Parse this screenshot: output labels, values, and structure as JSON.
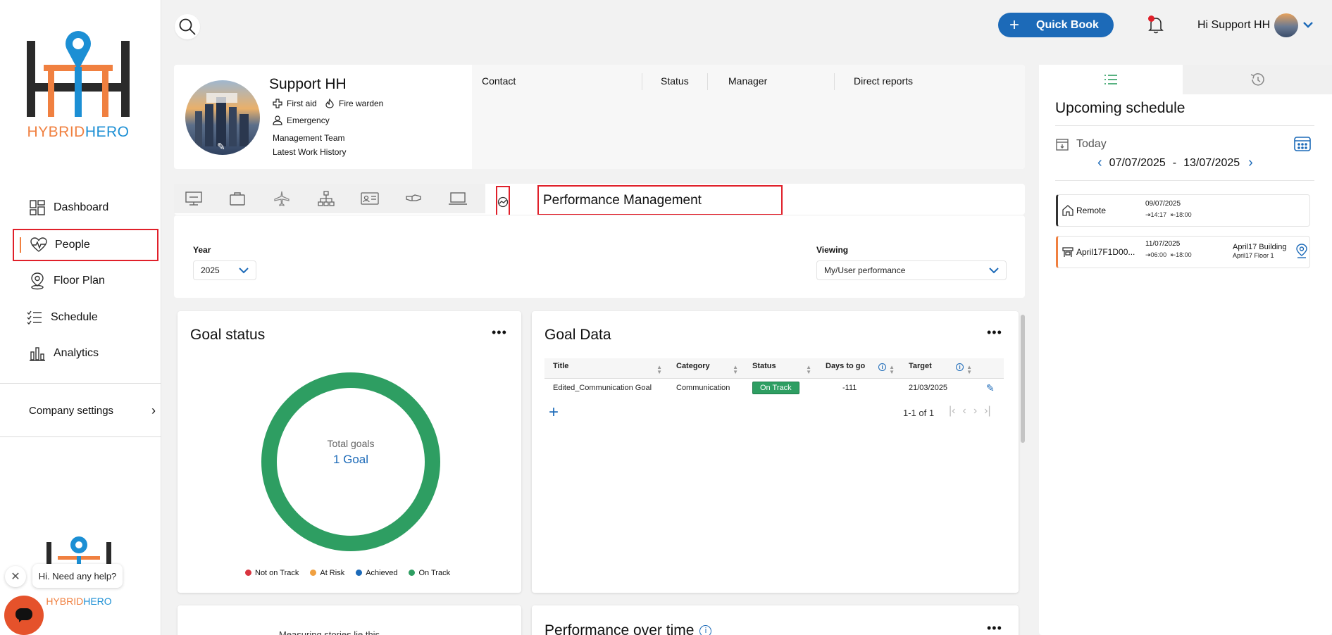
{
  "brand": {
    "name": "HYBRIDHERO",
    "name_part1": "HYBRID",
    "name_part2": "HERO",
    "orange": "#f08040",
    "blue": "#1c8fd4",
    "dark": "#2a2a2a"
  },
  "nav": {
    "items": [
      {
        "label": "Dashboard",
        "icon": "dashboard-icon"
      },
      {
        "label": "People",
        "icon": "heartbeat-icon"
      },
      {
        "label": "Floor Plan",
        "icon": "map-pin-icon"
      },
      {
        "label": "Schedule",
        "icon": "checklist-icon"
      },
      {
        "label": "Analytics",
        "icon": "bar-chart-icon"
      }
    ],
    "company_settings": "Company settings"
  },
  "topbar": {
    "quick_book": "Quick Book",
    "greeting": "Hi Support HH"
  },
  "profile": {
    "name": "Support HH",
    "badges": [
      "First aid",
      "Fire warden"
    ],
    "emergency": "Emergency",
    "team": "Management Team",
    "history": "Latest Work History",
    "columns": [
      "Contact",
      "Status",
      "Manager",
      "Direct reports"
    ]
  },
  "section_title": "Performance Management",
  "filters": {
    "year_label": "Year",
    "year_value": "2025",
    "viewing_label": "Viewing",
    "viewing_value": "My/User performance"
  },
  "goal_status": {
    "title": "Goal status",
    "center_label": "Total goals",
    "center_value": "1 Goal",
    "legend": [
      {
        "label": "Not on Track",
        "color": "#d9343f"
      },
      {
        "label": "At Risk",
        "color": "#f0a040"
      },
      {
        "label": "Achieved",
        "color": "#1c6ab8"
      },
      {
        "label": "On Track",
        "color": "#2e9e62"
      }
    ],
    "chart_data": {
      "type": "pie",
      "categories": [
        "Not on Track",
        "At Risk",
        "Achieved",
        "On Track"
      ],
      "values": [
        0,
        0,
        0,
        1
      ]
    }
  },
  "goal_data": {
    "title": "Goal Data",
    "headers": [
      "Title",
      "Category",
      "Status",
      "Days to go",
      "Target"
    ],
    "rows": [
      {
        "title": "Edited_Communication Goal",
        "category": "Communication",
        "status": "On Track",
        "days": "-111",
        "target": "21/03/2025"
      }
    ],
    "pagination": "1-1 of 1"
  },
  "bottom": {
    "left_text": "Measuring stories lie this",
    "perf_title": "Performance over time"
  },
  "schedule": {
    "title": "Upcoming schedule",
    "today": "Today",
    "range_start": "07/07/2025",
    "range_sep": "-",
    "range_end": "13/07/2025",
    "items": [
      {
        "name": "Remote",
        "date": "09/07/2025",
        "in": "14:17",
        "out": "18:00",
        "accent": "#333333"
      },
      {
        "name": "April17F1D00...",
        "date": "11/07/2025",
        "in": "06:00",
        "out": "18:00",
        "building": "April17 Building",
        "floor": "April17 Floor 1",
        "accent": "#f08040"
      }
    ]
  },
  "help": {
    "text": "Hi. Need any help?"
  }
}
